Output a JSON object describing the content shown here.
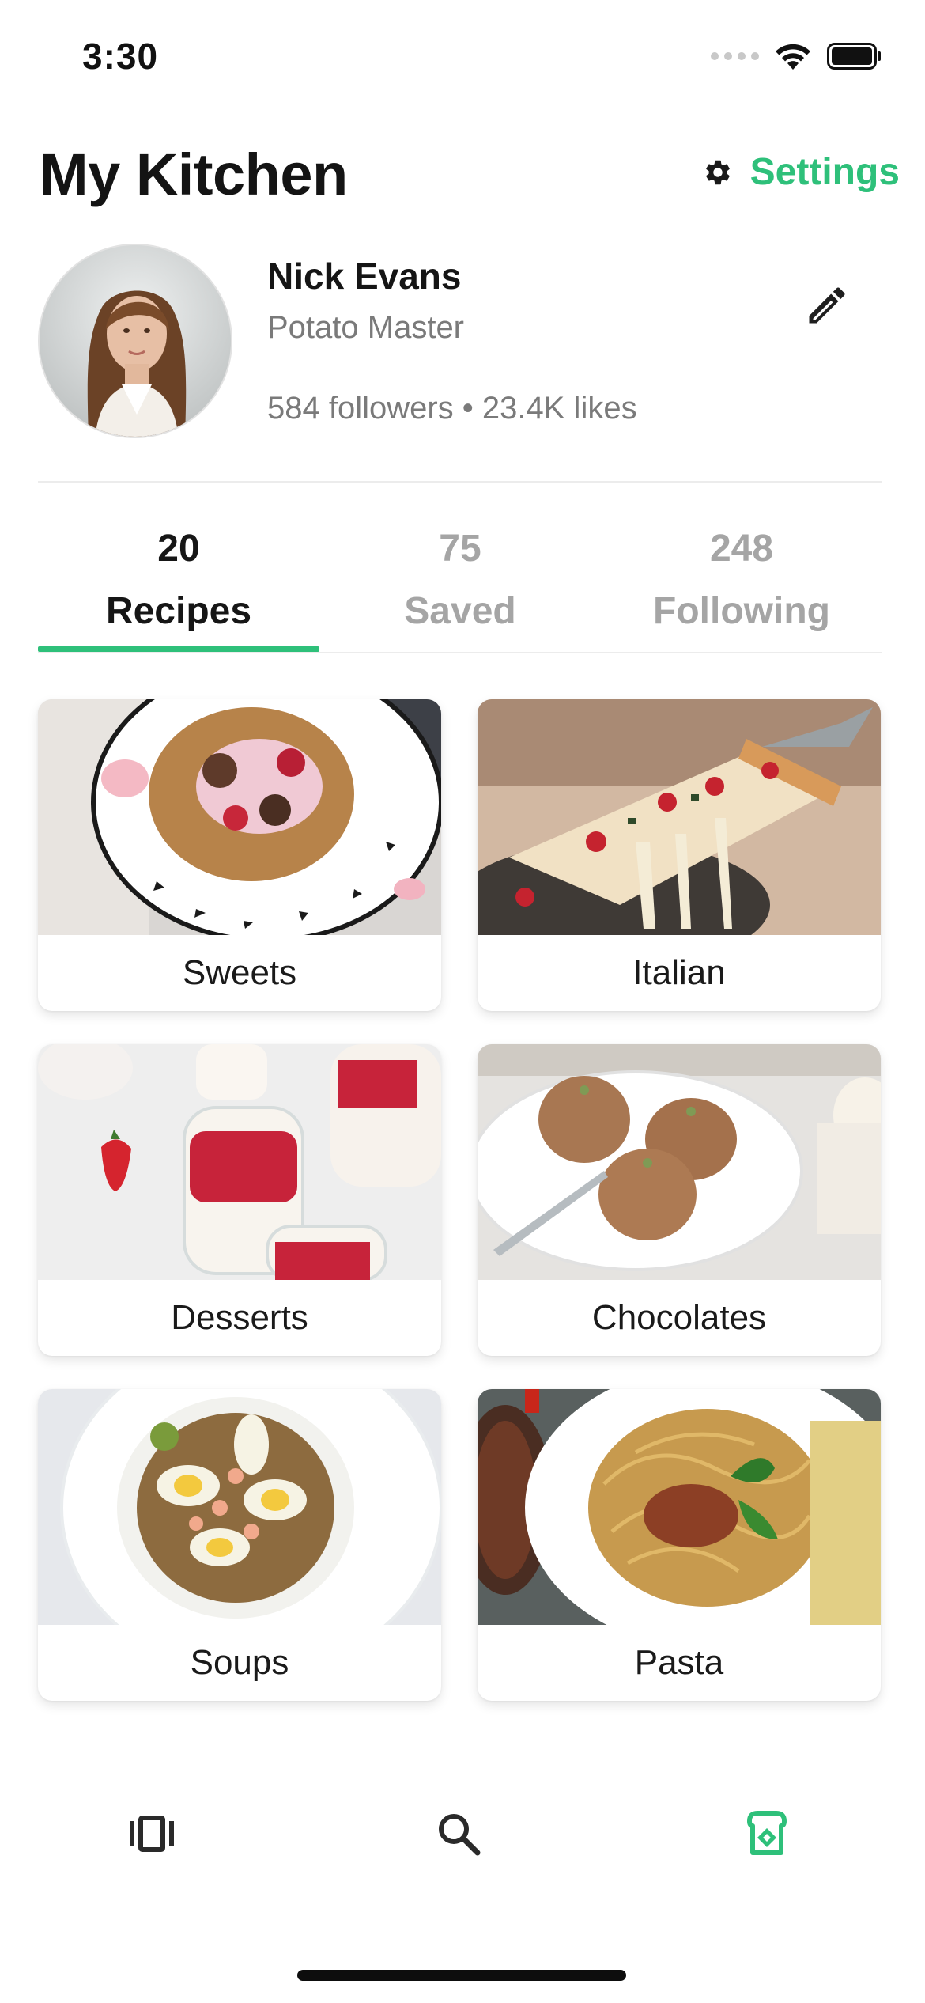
{
  "status_bar": {
    "time": "3:30"
  },
  "header": {
    "title": "My Kitchen",
    "settings_label": "Settings"
  },
  "profile": {
    "name": "Nick Evans",
    "role": "Potato Master",
    "stats": "584 followers • 23.4K likes"
  },
  "tabs": [
    {
      "count": "20",
      "label": "Recipes",
      "active": true
    },
    {
      "count": "75",
      "label": "Saved",
      "active": false
    },
    {
      "count": "248",
      "label": "Following",
      "active": false
    }
  ],
  "categories": [
    {
      "label": "Sweets"
    },
    {
      "label": "Italian"
    },
    {
      "label": "Desserts"
    },
    {
      "label": "Chocolates"
    },
    {
      "label": "Soups"
    },
    {
      "label": "Pasta"
    }
  ],
  "bottom_nav": [
    {
      "icon": "cards-carousel-icon",
      "active": false
    },
    {
      "icon": "search-icon",
      "active": false
    },
    {
      "icon": "kitchen-toaster-icon",
      "active": true
    }
  ],
  "colors": {
    "accent": "#2ec07a",
    "text_primary": "#141414",
    "text_secondary": "#7a7a7a",
    "tab_inactive": "#a5a5a5",
    "divider": "#ececec"
  }
}
